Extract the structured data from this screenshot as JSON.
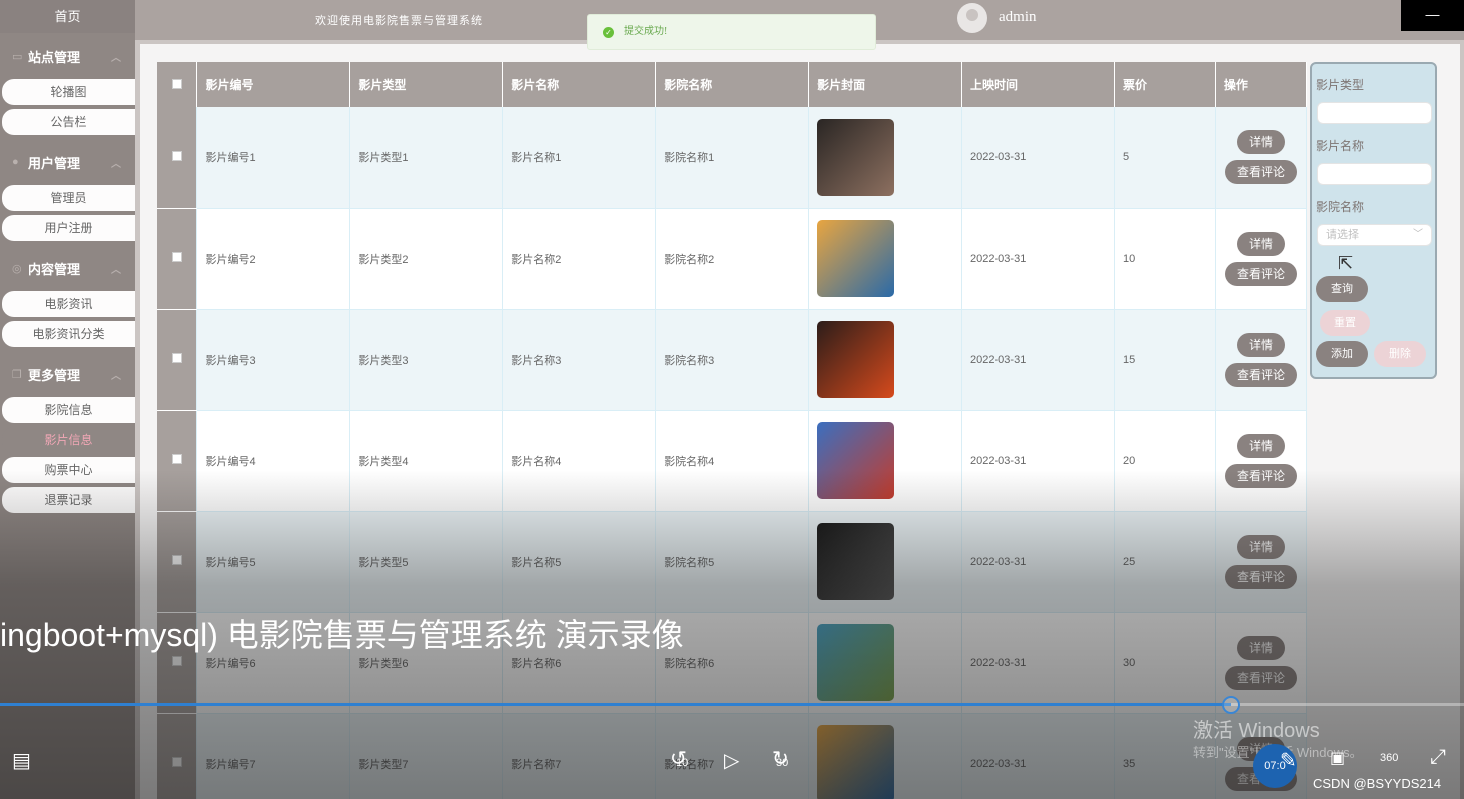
{
  "sidebar": {
    "home": "首页",
    "groups": [
      {
        "title": "站点管理",
        "items": [
          "轮播图",
          "公告栏"
        ]
      },
      {
        "title": "用户管理",
        "items": [
          "管理员",
          "用户注册"
        ]
      },
      {
        "title": "内容管理",
        "items": [
          "电影资讯",
          "电影资讯分类"
        ]
      },
      {
        "title": "更多管理",
        "items": [
          "影院信息",
          "影片信息",
          "购票中心",
          "退票记录"
        ]
      }
    ],
    "active_item": "影片信息"
  },
  "header": {
    "welcome": "欢迎使用电影院售票与管理系统",
    "username": "admin",
    "minimize": "—"
  },
  "toast": {
    "message": "提交成功!",
    "icon": "check-icon"
  },
  "table": {
    "columns": [
      "影片编号",
      "影片类型",
      "影片名称",
      "影院名称",
      "影片封面",
      "上映时间",
      "票价",
      "操作"
    ],
    "rows": [
      {
        "code": "影片编号1",
        "type": "影片类型1",
        "name": "影片名称1",
        "cinema": "影院名称1",
        "date": "2022-03-31",
        "price": "5",
        "poster_colors": [
          "#2a2624",
          "#8d7060"
        ]
      },
      {
        "code": "影片编号2",
        "type": "影片类型2",
        "name": "影片名称2",
        "cinema": "影院名称2",
        "date": "2022-03-31",
        "price": "10",
        "poster_colors": [
          "#e8a540",
          "#2a6aa8"
        ]
      },
      {
        "code": "影片编号3",
        "type": "影片类型3",
        "name": "影片名称3",
        "cinema": "影院名称3",
        "date": "2022-03-31",
        "price": "15",
        "poster_colors": [
          "#2c1d1a",
          "#d64a1c"
        ]
      },
      {
        "code": "影片编号4",
        "type": "影片类型4",
        "name": "影片名称4",
        "cinema": "影院名称4",
        "date": "2022-03-31",
        "price": "20",
        "poster_colors": [
          "#3b6fbf",
          "#c53c2c"
        ]
      },
      {
        "code": "影片编号5",
        "type": "影片类型5",
        "name": "影片名称5",
        "cinema": "影院名称5",
        "date": "2022-03-31",
        "price": "25",
        "poster_colors": [
          "#1a1a1a",
          "#555555"
        ]
      },
      {
        "code": "影片编号6",
        "type": "影片类型6",
        "name": "影片名称6",
        "cinema": "影院名称6",
        "date": "2022-03-31",
        "price": "30",
        "poster_colors": [
          "#4aa3c8",
          "#7aa04a"
        ]
      },
      {
        "code": "影片编号7",
        "type": "影片类型7",
        "name": "影片名称7",
        "cinema": "影院名称7",
        "date": "2022-03-31",
        "price": "35",
        "poster_colors": [
          "#e8a540",
          "#2a6aa8"
        ]
      }
    ],
    "detail_label": "详情",
    "review_label": "查看评论"
  },
  "search": {
    "type_label": "影片类型",
    "name_label": "影片名称",
    "cinema_label": "影院名称",
    "cinema_placeholder": "请选择",
    "query_button": "查询",
    "reset_button": "重置",
    "add_button": "添加",
    "delete_button": "删除"
  },
  "video": {
    "title": "ingboot+mysql) 电影院售票与管理系统 演示录像",
    "progress": 0.841,
    "rewind_label": "10",
    "forward_label": "30",
    "watermark_main": "激活 Windows",
    "watermark_sub": "转到\"设置\"以激活 Windows。",
    "badge": "07:0",
    "credit": "CSDN @BSYYDS214",
    "label_360": "360"
  },
  "colors": {
    "accent": "#8a8280",
    "active_text": "#f1a7b6",
    "progress": "#2f80d1"
  }
}
